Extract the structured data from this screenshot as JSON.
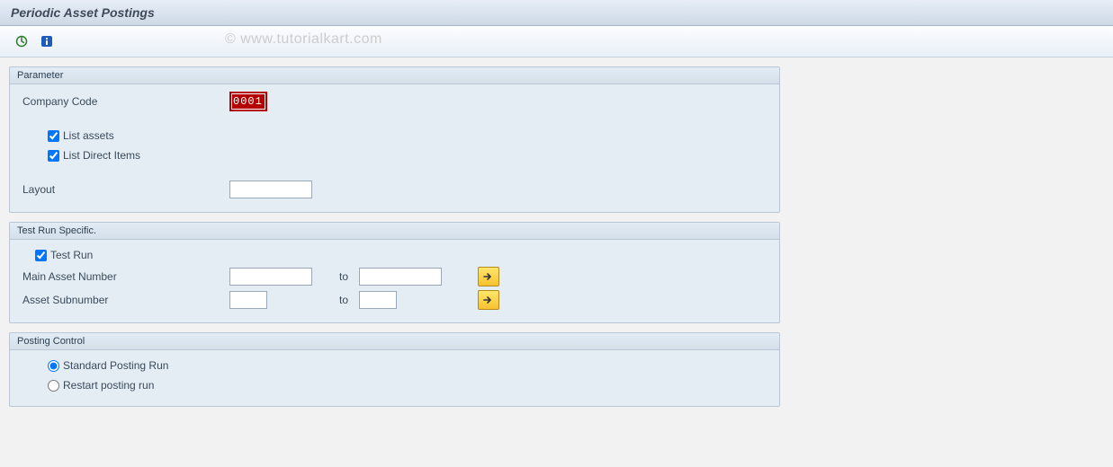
{
  "header": {
    "title": "Periodic Asset Postings"
  },
  "toolbar": {
    "execute_icon": "execute",
    "info_icon": "info"
  },
  "watermark": "© www.tutorialkart.com",
  "param": {
    "legend": "Parameter",
    "company_code_label": "Company Code",
    "company_code_value": "0001",
    "list_assets_label": "List assets",
    "list_assets_checked": true,
    "list_direct_label": "List Direct Items",
    "list_direct_checked": true,
    "layout_label": "Layout",
    "layout_value": ""
  },
  "testrun": {
    "legend": "Test Run Specific.",
    "test_run_label": "Test Run",
    "test_run_checked": true,
    "main_asset_label": "Main Asset Number",
    "main_asset_from": "",
    "main_asset_to": "",
    "asset_sub_label": "Asset Subnumber",
    "asset_sub_from": "",
    "asset_sub_to": "",
    "to_word": "to"
  },
  "posting": {
    "legend": "Posting Control",
    "standard_label": "Standard Posting Run",
    "restart_label": "Restart posting run",
    "selected": "standard"
  }
}
